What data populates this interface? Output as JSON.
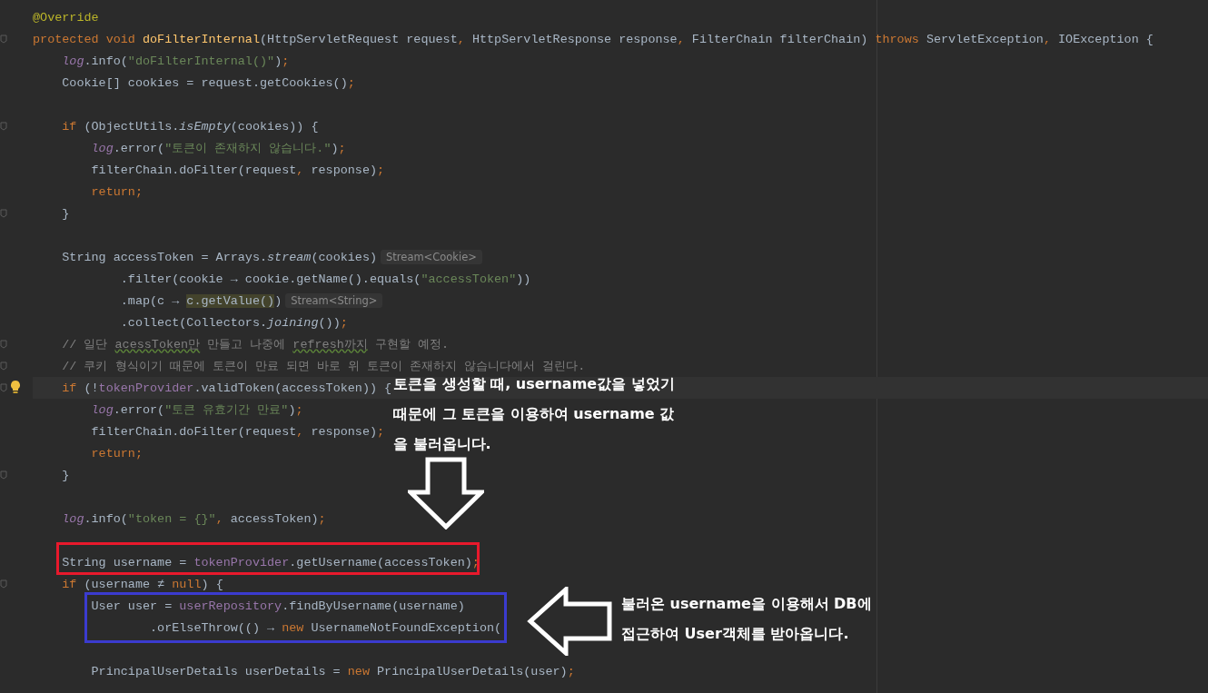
{
  "editor": {
    "lines": [
      {
        "kind": "code",
        "tokens": [
          {
            "t": "@Override",
            "kind": "annotation"
          }
        ]
      },
      {
        "kind": "code",
        "fold": true,
        "tokens": [
          {
            "t": "protected void ",
            "kind": "keyword"
          },
          {
            "t": "doFilterInternal",
            "kind": "method"
          },
          {
            "t": "(HttpServletRequest request",
            "kind": "plain"
          },
          {
            "t": ", ",
            "kind": "keyword"
          },
          {
            "t": "HttpServletResponse response",
            "kind": "plain"
          },
          {
            "t": ", ",
            "kind": "keyword"
          },
          {
            "t": "FilterChain filterChain) ",
            "kind": "plain"
          },
          {
            "t": "throws ",
            "kind": "keyword"
          },
          {
            "t": "ServletException",
            "kind": "plain"
          },
          {
            "t": ", ",
            "kind": "keyword"
          },
          {
            "t": "IOException {",
            "kind": "plain"
          }
        ]
      },
      {
        "kind": "code",
        "tokens": [
          {
            "t": "    log",
            "kind": "static-field"
          },
          {
            "t": ".info(",
            "kind": "plain"
          },
          {
            "t": "\"doFilterInternal()\"",
            "kind": "string"
          },
          {
            "t": ")",
            "kind": "plain"
          },
          {
            "t": ";",
            "kind": "keyword"
          }
        ]
      },
      {
        "kind": "code",
        "tokens": [
          {
            "t": "    Cookie[] cookies = request.getCookies()",
            "kind": "plain"
          },
          {
            "t": ";",
            "kind": "keyword"
          }
        ]
      },
      {
        "kind": "blank"
      },
      {
        "kind": "code",
        "fold": true,
        "tokens": [
          {
            "t": "    if ",
            "kind": "keyword"
          },
          {
            "t": "(ObjectUtils.",
            "kind": "plain"
          },
          {
            "t": "isEmpty",
            "kind": "static"
          },
          {
            "t": "(cookies)) {",
            "kind": "plain"
          }
        ]
      },
      {
        "kind": "code",
        "tokens": [
          {
            "t": "        log",
            "kind": "static-field"
          },
          {
            "t": ".error(",
            "kind": "plain"
          },
          {
            "t": "\"토큰이 존재하지 않습니다.\"",
            "kind": "string"
          },
          {
            "t": ")",
            "kind": "plain"
          },
          {
            "t": ";",
            "kind": "keyword"
          }
        ]
      },
      {
        "kind": "code",
        "tokens": [
          {
            "t": "        filterChain.doFilter(request",
            "kind": "plain"
          },
          {
            "t": ", ",
            "kind": "keyword"
          },
          {
            "t": "response)",
            "kind": "plain"
          },
          {
            "t": ";",
            "kind": "keyword"
          }
        ]
      },
      {
        "kind": "code",
        "tokens": [
          {
            "t": "        return;",
            "kind": "keyword"
          }
        ]
      },
      {
        "kind": "code",
        "fold": true,
        "tokens": [
          {
            "t": "    }",
            "kind": "plain"
          }
        ]
      },
      {
        "kind": "blank"
      },
      {
        "kind": "code",
        "tokens": [
          {
            "t": "    String accessToken = Arrays.",
            "kind": "plain"
          },
          {
            "t": "stream",
            "kind": "static"
          },
          {
            "t": "(cookies)",
            "kind": "plain"
          }
        ],
        "hint": "Stream<Cookie>"
      },
      {
        "kind": "code",
        "tokens": [
          {
            "t": "            .filter(cookie → cookie.getName().equals(",
            "kind": "plain"
          },
          {
            "t": "\"accessToken\"",
            "kind": "string"
          },
          {
            "t": "))",
            "kind": "plain"
          }
        ]
      },
      {
        "kind": "code",
        "tokens": [
          {
            "t": "            .map(c → ",
            "kind": "plain"
          },
          {
            "t": "c.getValue()",
            "kind": "highlighted"
          },
          {
            "t": ")",
            "kind": "plain"
          }
        ],
        "hint": "Stream<String>"
      },
      {
        "kind": "code",
        "tokens": [
          {
            "t": "            .collect(Collectors.",
            "kind": "plain"
          },
          {
            "t": "joining",
            "kind": "static"
          },
          {
            "t": "())",
            "kind": "plain"
          },
          {
            "t": ";",
            "kind": "keyword"
          }
        ]
      },
      {
        "kind": "code",
        "fold": true,
        "tokens": [
          {
            "t": "    // 일단 ",
            "kind": "comment"
          },
          {
            "t": "acessToken만",
            "kind": "typo"
          },
          {
            "t": " 만들고 나중에 ",
            "kind": "comment"
          },
          {
            "t": "refresh까지",
            "kind": "typo"
          },
          {
            "t": " 구현할 예정.",
            "kind": "comment"
          }
        ]
      },
      {
        "kind": "code",
        "fold": true,
        "tokens": [
          {
            "t": "    // 쿠키 형식이기 때문에 토큰이 만료 되면 바로 위 토큰이 존재하지 않습니다에서 걸린다.",
            "kind": "comment"
          }
        ]
      },
      {
        "kind": "code",
        "fold": true,
        "current": true,
        "bulb": true,
        "tokens": [
          {
            "t": "    if ",
            "kind": "keyword"
          },
          {
            "t": "(!",
            "kind": "plain"
          },
          {
            "t": "tokenProvider",
            "kind": "field"
          },
          {
            "t": ".validToken(accessToken)) {",
            "kind": "plain"
          }
        ]
      },
      {
        "kind": "code",
        "tokens": [
          {
            "t": "        log",
            "kind": "static-field"
          },
          {
            "t": ".error(",
            "kind": "plain"
          },
          {
            "t": "\"토큰 유효기간 만료\"",
            "kind": "string"
          },
          {
            "t": ")",
            "kind": "plain"
          },
          {
            "t": ";",
            "kind": "keyword"
          }
        ]
      },
      {
        "kind": "code",
        "tokens": [
          {
            "t": "        filterChain.doFilter(request",
            "kind": "plain"
          },
          {
            "t": ", ",
            "kind": "keyword"
          },
          {
            "t": "response)",
            "kind": "plain"
          },
          {
            "t": ";",
            "kind": "keyword"
          }
        ]
      },
      {
        "kind": "code",
        "tokens": [
          {
            "t": "        return;",
            "kind": "keyword"
          }
        ]
      },
      {
        "kind": "code",
        "fold": true,
        "tokens": [
          {
            "t": "    }",
            "kind": "plain"
          }
        ]
      },
      {
        "kind": "blank"
      },
      {
        "kind": "code",
        "tokens": [
          {
            "t": "    log",
            "kind": "static-field"
          },
          {
            "t": ".info(",
            "kind": "plain"
          },
          {
            "t": "\"token = {}\"",
            "kind": "string"
          },
          {
            "t": ", ",
            "kind": "keyword"
          },
          {
            "t": "accessToken)",
            "kind": "plain"
          },
          {
            "t": ";",
            "kind": "keyword"
          }
        ]
      },
      {
        "kind": "blank"
      },
      {
        "kind": "code",
        "tokens": [
          {
            "t": "    String username = ",
            "kind": "plain"
          },
          {
            "t": "tokenProvider",
            "kind": "field"
          },
          {
            "t": ".getUsername(accessToken)",
            "kind": "plain"
          },
          {
            "t": ";",
            "kind": "keyword"
          }
        ]
      },
      {
        "kind": "code",
        "fold": true,
        "tokens": [
          {
            "t": "    if ",
            "kind": "keyword"
          },
          {
            "t": "(username ≠ ",
            "kind": "plain"
          },
          {
            "t": "null",
            "kind": "keyword"
          },
          {
            "t": ") {",
            "kind": "plain"
          }
        ]
      },
      {
        "kind": "code",
        "tokens": [
          {
            "t": "        User user = ",
            "kind": "plain"
          },
          {
            "t": "userRepository",
            "kind": "field"
          },
          {
            "t": ".findByUsername(username)",
            "kind": "plain"
          }
        ]
      },
      {
        "kind": "code",
        "tokens": [
          {
            "t": "                .orElseThrow(() → ",
            "kind": "plain"
          },
          {
            "t": "new ",
            "kind": "keyword"
          },
          {
            "t": "UsernameNotFoundException(",
            "kind": "plain"
          }
        ]
      },
      {
        "kind": "blank"
      },
      {
        "kind": "code",
        "tokens": [
          {
            "t": "        PrincipalUserDetails userDetails = ",
            "kind": "plain"
          },
          {
            "t": "new ",
            "kind": "keyword"
          },
          {
            "t": "PrincipalUserDetails(user)",
            "kind": "plain"
          },
          {
            "t": ";",
            "kind": "keyword"
          }
        ]
      }
    ]
  },
  "annotations": [
    {
      "kind": "note",
      "lines": [
        "토큰을 생성할 때, username값을 넣었기",
        "때문에 그 토큰을 이용하여 username 값",
        "을 불러옵니다."
      ]
    },
    {
      "kind": "arrow-down"
    },
    {
      "kind": "box",
      "color": "#e8192c"
    },
    {
      "kind": "box",
      "color": "#3b3bcf"
    },
    {
      "kind": "arrow-left"
    },
    {
      "kind": "note",
      "lines": [
        "불러온 username을 이용해서 DB에",
        "접근하여 User객체를 받아옵니다."
      ]
    }
  ]
}
